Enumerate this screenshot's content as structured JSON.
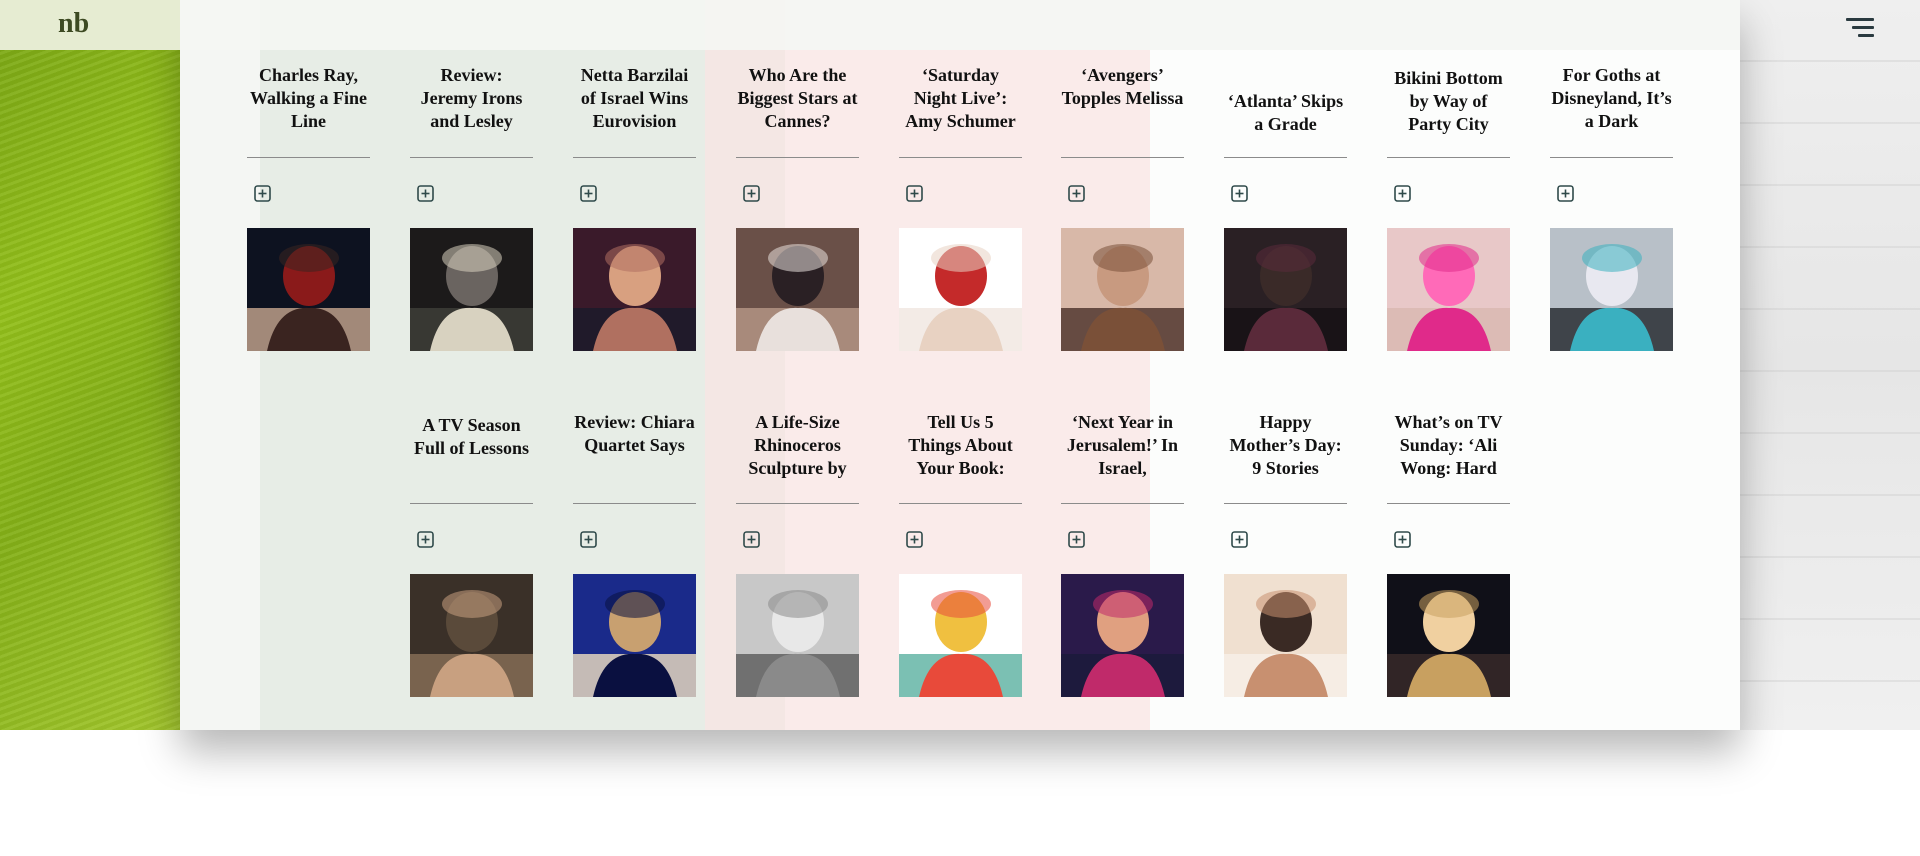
{
  "brand": {
    "logo_text": "nb"
  },
  "colors": {
    "icon_stroke": "#2f4a4a",
    "title_text": "#111111",
    "menu_icon": "#2a3a40"
  },
  "articles": [
    {
      "title": "Charles Ray, Walking a Fine Line",
      "thumb": {
        "icon": "portrait-photo",
        "palette": [
          "#0d1220",
          "#3a2420",
          "#8a1a1a",
          "#c8a890"
        ]
      }
    },
    {
      "title": "Review: Jeremy Irons and Lesley",
      "thumb": {
        "icon": "stage-photo",
        "palette": [
          "#1c1a1a",
          "#d8d2c0",
          "#6a6460",
          "#40403a"
        ]
      }
    },
    {
      "title": "Netta Barzilai of Israel Wins Eurovision",
      "thumb": {
        "icon": "singer-photo",
        "palette": [
          "#3a1a2a",
          "#b07060",
          "#d8a080",
          "#1a1a2a"
        ]
      }
    },
    {
      "title": "Who Are the Biggest Stars at Cannes?",
      "thumb": {
        "icon": "group-photo",
        "palette": [
          "#6a5048",
          "#e8e0dc",
          "#2a2024",
          "#b89888"
        ]
      }
    },
    {
      "title": "‘Saturday Night Live’: Amy Schumer",
      "thumb": {
        "icon": "bonnet-photo",
        "palette": [
          "#ffffff",
          "#e8d2c2",
          "#c42a2a",
          "#f0e6e0"
        ]
      }
    },
    {
      "title": "‘Avengers’ Topples Melissa",
      "thumb": {
        "icon": "glasses-photo",
        "palette": [
          "#d8b8a8",
          "#7a5038",
          "#c89a80",
          "#4a3028"
        ]
      }
    },
    {
      "title": "‘Atlanta’ Skips a Grade",
      "thumb": {
        "icon": "man-photo",
        "palette": [
          "#2a2024",
          "#5a2a3a",
          "#3a2a28",
          "#151014"
        ]
      }
    },
    {
      "title": "Bikini Bottom by Way of Party City",
      "thumb": {
        "icon": "costume-photo",
        "palette": [
          "#e8c8c8",
          "#e02a8a",
          "#ff6ab8",
          "#d8b8b0"
        ]
      }
    },
    {
      "title": "For Goths at Disneyland, It’s a Dark",
      "thumb": {
        "icon": "goth-photo",
        "palette": [
          "#b8c0c8",
          "#3ab0c0",
          "#e8e8f0",
          "#20242a"
        ]
      }
    },
    {
      "title": "A TV Season Full of Lessons",
      "thumb": {
        "icon": "actor-photo",
        "palette": [
          "#3a3028",
          "#c8a080",
          "#5a4a3a",
          "#8a7058"
        ]
      }
    },
    {
      "title": "Review: Chiara Quartet Says",
      "thumb": {
        "icon": "quartet-photo",
        "palette": [
          "#1a2a8a",
          "#0a1040",
          "#c8a070",
          "#f0e0c0"
        ]
      }
    },
    {
      "title": "A Life-Size Rhinoceros Sculpture by",
      "thumb": {
        "icon": "sculpture-photo",
        "palette": [
          "#c8c8c8",
          "#8a8a8a",
          "#e8e8e8",
          "#5a5a5a"
        ]
      }
    },
    {
      "title": "Tell Us 5 Things About Your Book:",
      "thumb": {
        "icon": "book-cover",
        "palette": [
          "#ffffff",
          "#e84a3a",
          "#f0c040",
          "#5ab0a0"
        ]
      }
    },
    {
      "title": "‘Next Year in Jerusalem!’ In Israel,",
      "thumb": {
        "icon": "singer-photo",
        "palette": [
          "#2a1a4a",
          "#c02a6a",
          "#e0a080",
          "#1a1a3a"
        ]
      }
    },
    {
      "title": "Happy Mother’s Day: 9 Stories",
      "thumb": {
        "icon": "mother-photo",
        "palette": [
          "#f0e0d0",
          "#c89070",
          "#3a2a24",
          "#f8f0e8"
        ]
      }
    },
    {
      "title": "What’s on TV Sunday: ‘Ali Wong: Hard",
      "thumb": {
        "icon": "comedian-photo",
        "palette": [
          "#101018",
          "#c8a060",
          "#f0d0a0",
          "#3a2a2a"
        ]
      }
    }
  ]
}
